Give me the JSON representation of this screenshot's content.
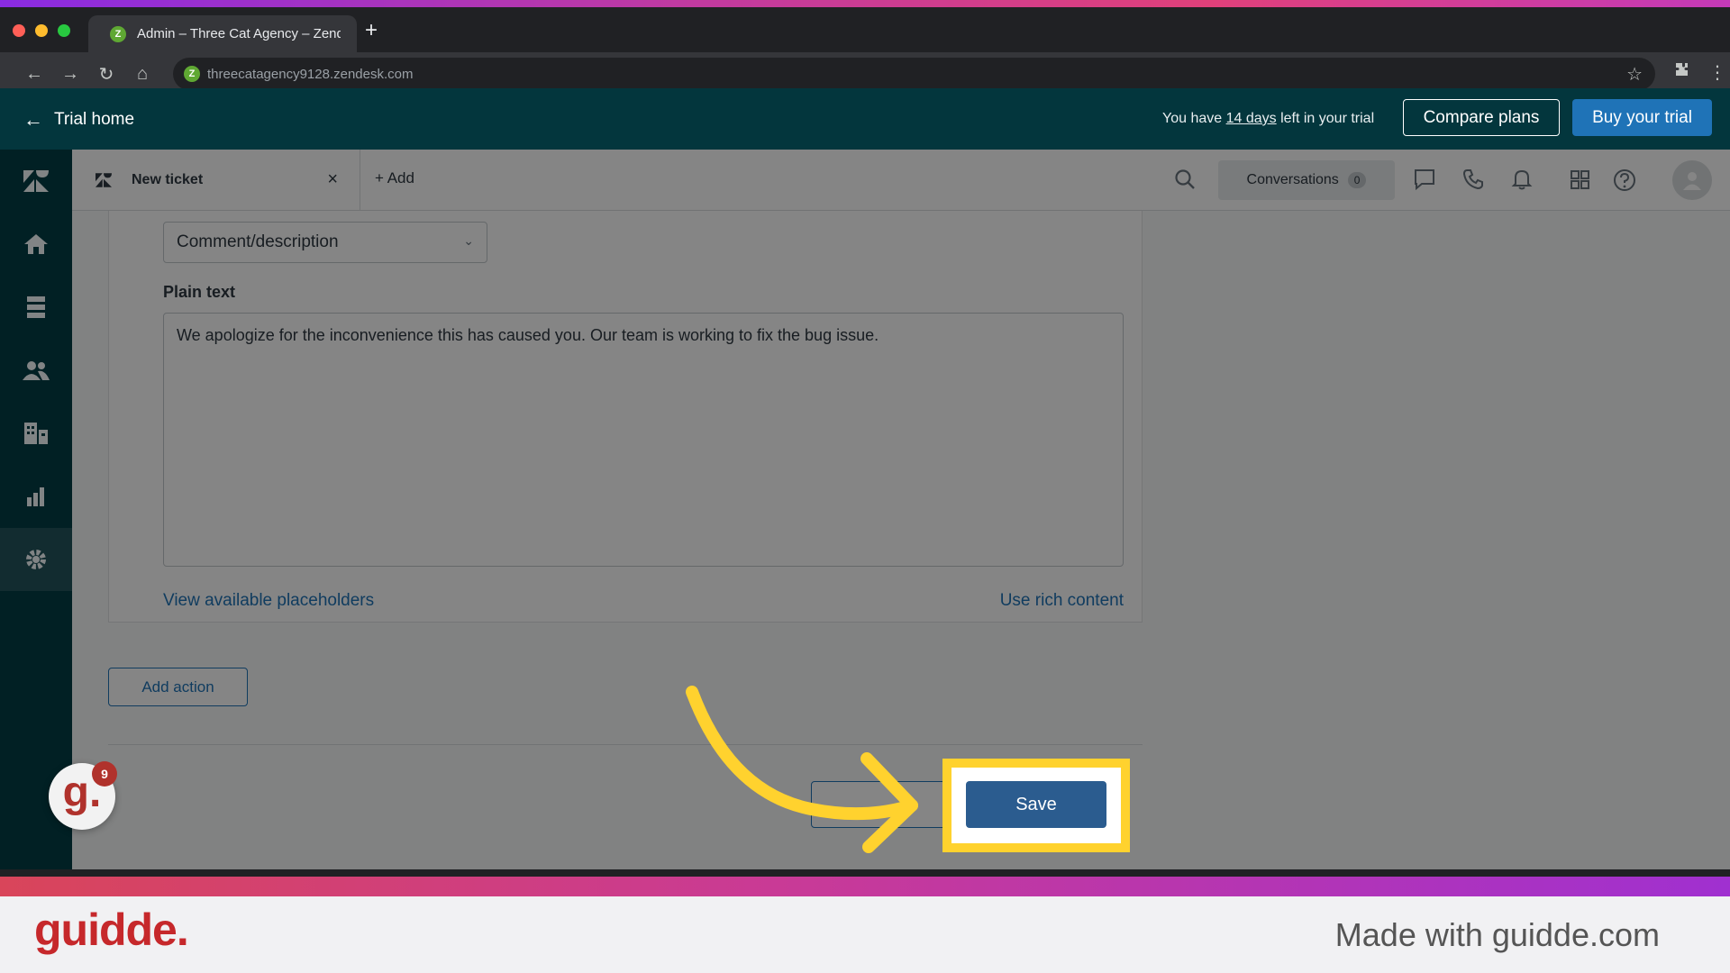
{
  "browser": {
    "tab_title": "Admin – Three Cat Agency – Zend",
    "url": "threecatagency9128.zendesk.com",
    "favicon_letter": "Z"
  },
  "trial": {
    "home_label": "Trial home",
    "days_prefix": "You have ",
    "days_link": "14 days",
    "days_suffix": " left in your trial",
    "compare_label": "Compare plans",
    "buy_label": "Buy your trial"
  },
  "header": {
    "ticket_tab": "New ticket",
    "add_label": "+ Add",
    "conversations_label": "Conversations",
    "conversations_count": "0"
  },
  "form": {
    "field_select": "Comment/description",
    "plain_text_label": "Plain text",
    "comment_text": "We apologize for the inconvenience this has caused you. Our team is working to fix the bug issue.",
    "placeholders_link": "View available placeholders",
    "rich_content_link": "Use rich content",
    "add_action_label": "Add action",
    "save_label": "Save"
  },
  "guidde": {
    "badge_letter": "g.",
    "badge_count": "9",
    "logo": "guidde.",
    "made_with": "Made with guidde.com"
  },
  "colors": {
    "highlight": "#ffd22e",
    "brand_blue": "#1f73b7",
    "nav_bg": "#03363d"
  }
}
